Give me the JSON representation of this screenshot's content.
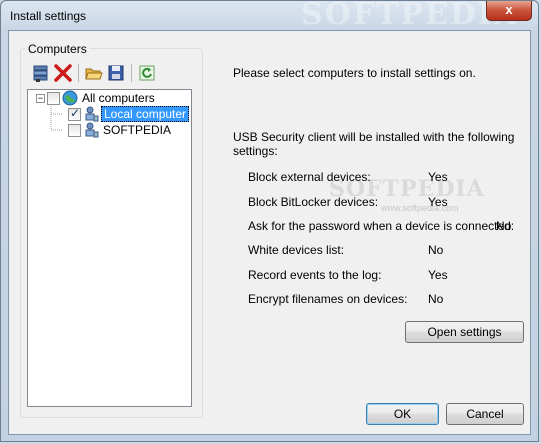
{
  "window": {
    "title": "Install settings",
    "close_glyph": "x",
    "watermark": "SOFTPEDIA"
  },
  "computers_group": {
    "label": "Computers",
    "toolbar": [
      {
        "icon": "scan-network-icon"
      },
      {
        "icon": "delete-icon"
      },
      {
        "icon": "open-folder-icon"
      },
      {
        "icon": "save-icon"
      },
      {
        "icon": "refresh-icon"
      }
    ],
    "tree": {
      "root": {
        "label": "All computers",
        "expander": "−",
        "checked": false
      },
      "children": [
        {
          "label": "Local computer",
          "checked": true,
          "selected": true
        },
        {
          "label": "SOFTPEDIA",
          "checked": false,
          "selected": false
        }
      ]
    }
  },
  "main": {
    "prompt": "Please select computers to install settings on.",
    "intro_line1": "USB Security client will be installed with the following",
    "intro_line2": "settings:",
    "settings": [
      {
        "label": "Block external devices:",
        "value": "Yes"
      },
      {
        "label": "Block BitLocker devices:",
        "value": "Yes"
      },
      {
        "label": "Ask for the password when a device is connected:",
        "value": "No"
      },
      {
        "label": "White devices list:",
        "value": "No"
      },
      {
        "label": "Record events to the log:",
        "value": "Yes"
      },
      {
        "label": "Encrypt filenames on devices:",
        "value": "No"
      }
    ],
    "open_settings_label": "Open settings",
    "watermark_big": "SOFTPEDIA",
    "watermark_small": "www.softpedia.com"
  },
  "footer": {
    "ok_label": "OK",
    "cancel_label": "Cancel"
  }
}
